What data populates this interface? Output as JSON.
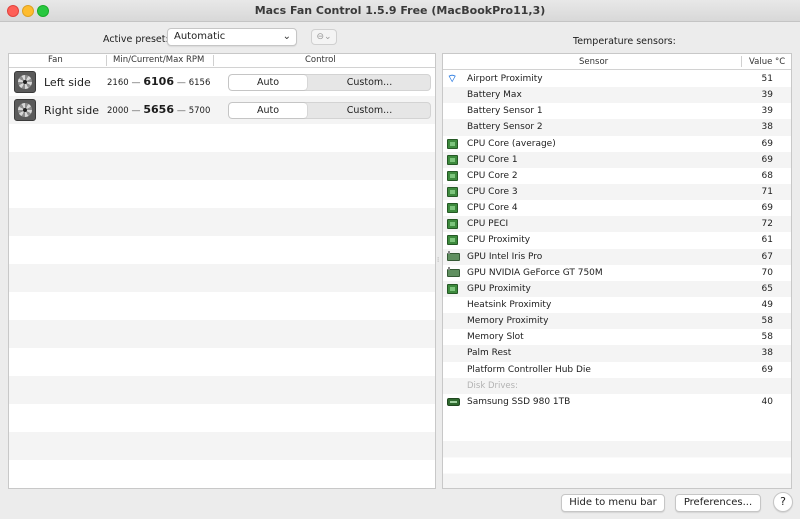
{
  "window": {
    "title": "Macs Fan Control 1.5.9 Free (MacBookPro11,3)"
  },
  "preset": {
    "label": "Active preset:",
    "value": "Automatic",
    "more_glyph": "⊖⌄"
  },
  "fan_table": {
    "headers": {
      "fan": "Fan",
      "rpm": "Min/Current/Max RPM",
      "control": "Control"
    },
    "rows": [
      {
        "name": "Left side",
        "min": "2160",
        "current": "6106",
        "max": "6156",
        "auto_label": "Auto",
        "custom_label": "Custom...",
        "selected": "Auto"
      },
      {
        "name": "Right side",
        "min": "2000",
        "current": "5656",
        "max": "5700",
        "auto_label": "Auto",
        "custom_label": "Custom...",
        "selected": "Auto"
      }
    ]
  },
  "sensors": {
    "label": "Temperature sensors:",
    "headers": {
      "sensor": "Sensor",
      "value": "Value °C"
    },
    "rows": [
      {
        "icon": "wifi-icon",
        "name": "Airport Proximity",
        "value": "51"
      },
      {
        "icon": "",
        "name": "Battery Max",
        "value": "39"
      },
      {
        "icon": "",
        "name": "Battery Sensor 1",
        "value": "39"
      },
      {
        "icon": "",
        "name": "Battery Sensor 2",
        "value": "38"
      },
      {
        "icon": "cpu-chip-icon",
        "name": "CPU Core (average)",
        "value": "69"
      },
      {
        "icon": "cpu-chip-icon",
        "name": "CPU Core 1",
        "value": "69"
      },
      {
        "icon": "cpu-chip-icon",
        "name": "CPU Core 2",
        "value": "68"
      },
      {
        "icon": "cpu-chip-icon",
        "name": "CPU Core 3",
        "value": "71"
      },
      {
        "icon": "cpu-chip-icon",
        "name": "CPU Core 4",
        "value": "69"
      },
      {
        "icon": "cpu-chip-icon",
        "name": "CPU PECI",
        "value": "72"
      },
      {
        "icon": "cpu-chip-icon",
        "name": "CPU Proximity",
        "value": "61"
      },
      {
        "icon": "gpu-card-icon",
        "name": "GPU Intel Iris Pro",
        "value": "67"
      },
      {
        "icon": "gpu-card-icon",
        "name": "GPU NVIDIA GeForce GT 750M",
        "value": "70"
      },
      {
        "icon": "cpu-chip-icon",
        "name": "GPU Proximity",
        "value": "65"
      },
      {
        "icon": "",
        "name": "Heatsink Proximity",
        "value": "49"
      },
      {
        "icon": "",
        "name": "Memory Proximity",
        "value": "58"
      },
      {
        "icon": "",
        "name": "Memory Slot",
        "value": "58"
      },
      {
        "icon": "",
        "name": "Palm Rest",
        "value": "38"
      },
      {
        "icon": "",
        "name": "Platform Controller Hub Die",
        "value": "69"
      },
      {
        "group": true,
        "name": "Disk Drives:"
      },
      {
        "icon": "ssd-drive-icon",
        "name": "Samsung SSD 980 1TB",
        "value": "40"
      }
    ]
  },
  "buttons": {
    "hide": "Hide to menu bar",
    "preferences": "Preferences...",
    "help": "?"
  },
  "colors": {
    "close": "#fe5f57",
    "minimize": "#febc2e",
    "maximize": "#28c840",
    "chip_green": "#3d8a3d",
    "wifi_blue": "#2f7de1"
  }
}
